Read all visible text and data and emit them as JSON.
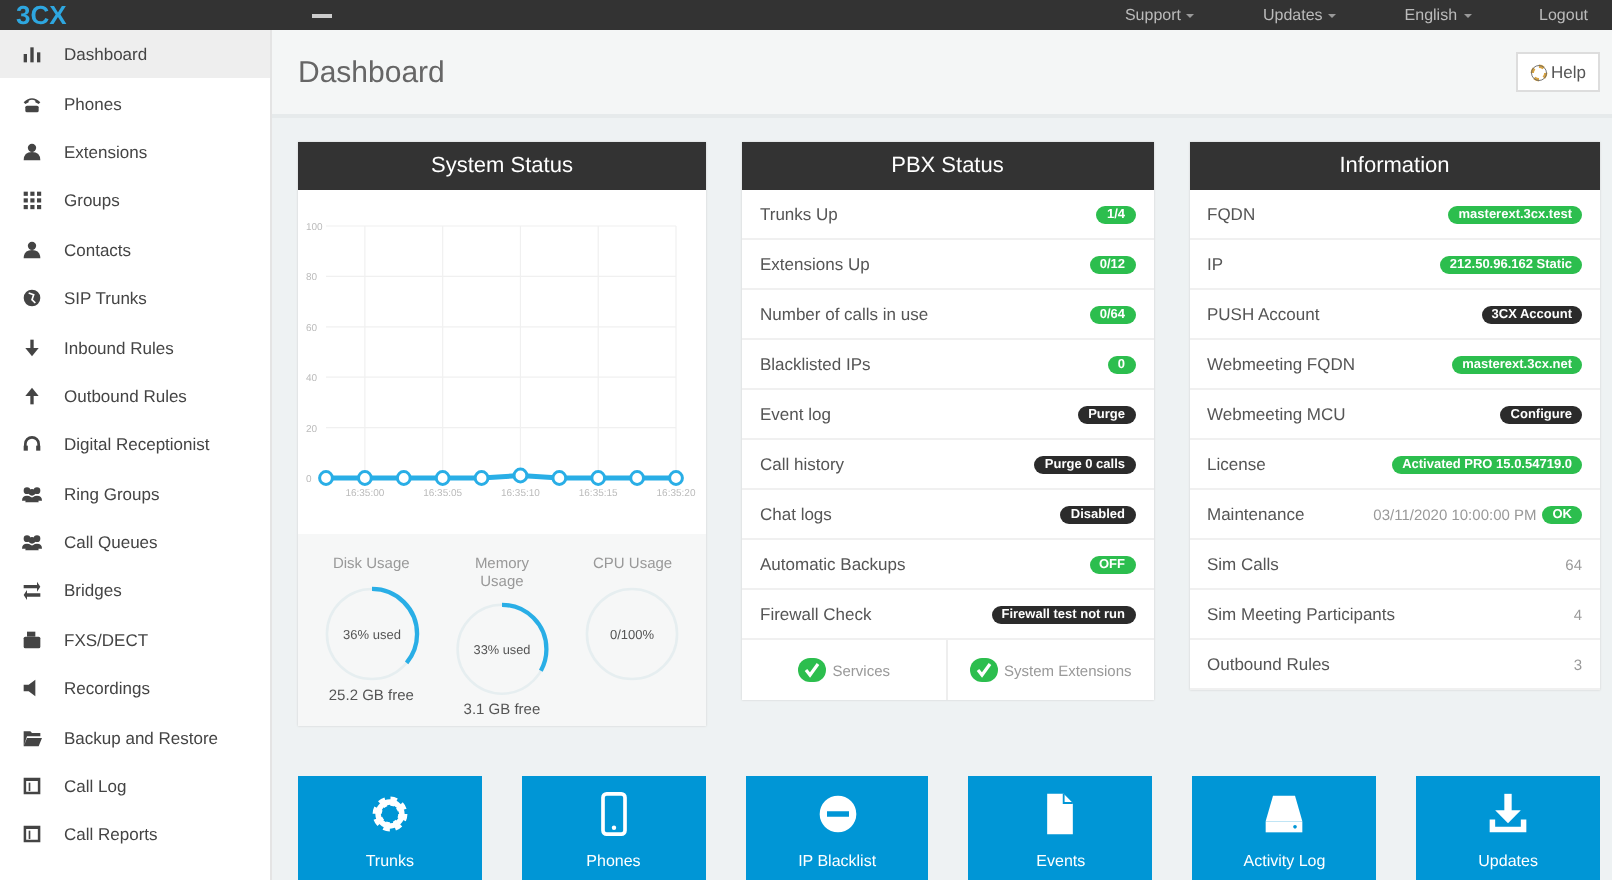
{
  "header": {
    "logo": "3CX",
    "menu": [
      {
        "label": "Support",
        "kind": "dropdown"
      },
      {
        "label": "Updates",
        "kind": "dropdown"
      },
      {
        "label": "English",
        "kind": "dropdown"
      },
      {
        "label": "Logout",
        "kind": "link"
      }
    ]
  },
  "sidebar": {
    "items": [
      {
        "label": "Dashboard",
        "kind": "bars",
        "selected": true
      },
      {
        "label": "Phones",
        "kind": "phone",
        "selected": false
      },
      {
        "label": "Extensions",
        "kind": "user",
        "selected": false
      },
      {
        "label": "Groups",
        "kind": "grid",
        "selected": false
      },
      {
        "label": "Contacts",
        "kind": "user",
        "selected": false
      },
      {
        "label": "SIP Trunks",
        "kind": "globe",
        "selected": false
      },
      {
        "label": "Inbound Rules",
        "kind": "down",
        "selected": false
      },
      {
        "label": "Outbound Rules",
        "kind": "up",
        "selected": false
      },
      {
        "label": "Digital Receptionist",
        "kind": "headset",
        "selected": false
      },
      {
        "label": "Ring Groups",
        "kind": "users",
        "selected": false
      },
      {
        "label": "Call Queues",
        "kind": "users",
        "selected": false
      },
      {
        "label": "Bridges",
        "kind": "swap",
        "selected": false
      },
      {
        "label": "FXS/DECT",
        "kind": "fax",
        "selected": false
      },
      {
        "label": "Recordings",
        "kind": "speaker",
        "selected": false
      },
      {
        "label": "Backup and Restore",
        "kind": "folder",
        "selected": false
      },
      {
        "label": "Call Log",
        "kind": "table",
        "selected": false
      },
      {
        "label": "Call Reports",
        "kind": "table",
        "selected": false
      }
    ]
  },
  "page": {
    "title": "Dashboard",
    "help_button": "Help"
  },
  "system_status": {
    "title": "System Status",
    "chart_data": {
      "type": "line",
      "categories": [
        null,
        "16:35:00",
        null,
        "16:35:05",
        null,
        "16:35:10",
        null,
        "16:35:15",
        null,
        "16:35:20"
      ],
      "grid": true,
      "series": [
        {
          "color": "#29aee6",
          "marker": "circle",
          "values": [
            0,
            0,
            0,
            0,
            0,
            1,
            0,
            0,
            0,
            0
          ]
        }
      ],
      "ylim": [
        0,
        100
      ],
      "yticks": [
        0,
        20,
        40,
        60,
        80,
        100
      ]
    },
    "gauges": [
      {
        "label": "Disk Usage",
        "reading": "36% used",
        "level": 0.36,
        "footer": "25.2 GB free"
      },
      {
        "label": "Memory Usage",
        "reading": "33% used",
        "level": 0.33,
        "footer": "3.1 GB free"
      },
      {
        "label": "CPU Usage",
        "reading": "0/100%",
        "level": 0
      }
    ]
  },
  "pbx_status": {
    "title": "PBX Status",
    "rows": [
      {
        "label": "Trunks Up",
        "badge": "1/4",
        "kind": "green"
      },
      {
        "label": "Extensions Up",
        "badge": "0/12",
        "kind": "green"
      },
      {
        "label": "Number of calls in use",
        "badge": "0/64",
        "kind": "green"
      },
      {
        "label": "Blacklisted IPs",
        "badge": "0",
        "kind": "green"
      },
      {
        "label": "Event log",
        "badge": "Purge",
        "kind": "dark"
      },
      {
        "label": "Call history",
        "badge": "Purge 0 calls",
        "kind": "dark"
      },
      {
        "label": "Chat logs",
        "badge": "Disabled",
        "kind": "dark"
      },
      {
        "label": "Automatic Backups",
        "badge": "OFF",
        "kind": "green"
      },
      {
        "label": "Firewall Check",
        "badge": "Firewall test not run",
        "kind": "dark"
      }
    ],
    "checks": [
      {
        "label": "Services",
        "ok": true
      },
      {
        "label": "System Extensions",
        "ok": true
      }
    ]
  },
  "information": {
    "title": "Information",
    "rows": [
      {
        "label": "FQDN",
        "badge": "masterext.3cx.test",
        "kind": "green"
      },
      {
        "label": "IP",
        "badge": "212.50.96.162 Static",
        "kind": "green"
      },
      {
        "label": "PUSH Account",
        "badge": "3CX Account",
        "kind": "dark"
      },
      {
        "label": "Webmeeting FQDN",
        "badge": "masterext.3cx.net",
        "kind": "green"
      },
      {
        "label": "Webmeeting MCU",
        "badge": "Configure",
        "kind": "dark"
      },
      {
        "label": "License",
        "badge": "Activated PRO 15.0.54719.0",
        "kind": "green"
      },
      {
        "label": "Maintenance",
        "text": "03/11/2020 10:00:00 PM",
        "badge": "OK",
        "kind": "green"
      },
      {
        "label": "Sim Calls",
        "text": "64"
      },
      {
        "label": "Sim Meeting Participants",
        "text": "4"
      },
      {
        "label": "Outbound Rules",
        "text": "3"
      }
    ]
  },
  "tiles": [
    {
      "label": "Trunks",
      "kind": "gear"
    },
    {
      "label": "Phones",
      "kind": "mobile"
    },
    {
      "label": "IP Blacklist",
      "kind": "minus"
    },
    {
      "label": "Events",
      "kind": "document"
    },
    {
      "label": "Activity Log",
      "kind": "drive"
    },
    {
      "label": "Updates",
      "kind": "download"
    }
  ]
}
